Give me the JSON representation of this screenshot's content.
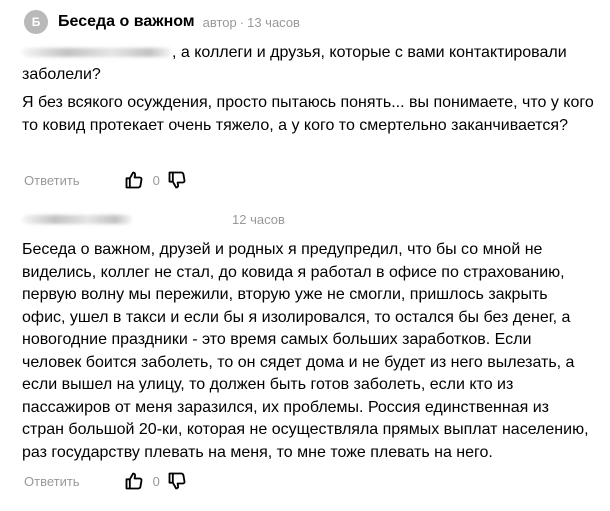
{
  "comment1": {
    "avatar_letter": "Б",
    "author": "Беседа о важном",
    "role": "автор",
    "separator": "·",
    "time": "13 часов",
    "quote_visible": ", а коллеги и друзья, которые с вами контактировали",
    "quote_line2": "заболели?",
    "text": "Я без всякого осуждения, просто пытаюсь понять... вы понимаете, что у кого то ковид протекает очень тяжело, а у кого то смертельно заканчивается?",
    "reply_label": "Ответить",
    "likes": "0"
  },
  "comment2": {
    "time": "12 часов",
    "text": "Беседа о важном, друзей и родных я предупредил, что бы со мной не виделись, коллег не стал, до ковида я работал в офисе по страхованию, первую волну мы пережили, вторую уже не смогли, пришлось закрыть офис, ушел в такси и если бы я изолировался, то остался бы без денег, а новогодние праздники - это время самых больших заработков. Если человек боится заболеть, то он сядет дома и не будет из него вылезать, а если вышел на улицу, то должен быть готов заболеть, если кто из пассажиров от меня заразился, их проблемы. Россия единственная из стран большой 20-ки, которая не осуществляла прямых выплат населению, раз государству плевать на меня, то мне тоже плевать на него.",
    "reply_label": "Ответить",
    "likes": "0"
  },
  "icons": {
    "like": "thumbs-up-icon",
    "dislike": "thumbs-down-icon"
  },
  "colors": {
    "meta": "#999999",
    "avatar_bg": "#b9b9b9",
    "text": "#000000"
  }
}
